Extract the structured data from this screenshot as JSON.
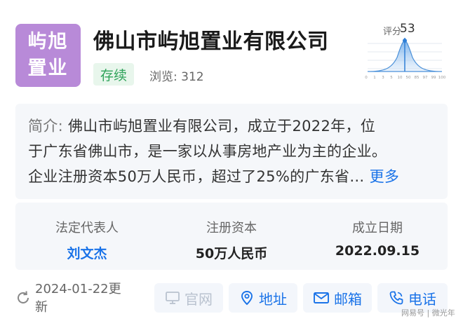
{
  "logo": {
    "line1": "屿旭",
    "line2": "置业",
    "color": "#b88ad8"
  },
  "company": {
    "name": "佛山市屿旭置业有限公司"
  },
  "status": {
    "label": "存续",
    "color": "#2fa35a"
  },
  "views": {
    "label": "浏览: 312"
  },
  "score": {
    "label": "评分",
    "value": "53",
    "ticks": [
      "0",
      "1",
      "3",
      "5",
      "10",
      "50",
      "85",
      "97",
      "99",
      "100"
    ]
  },
  "intro": {
    "prefix": "简介:",
    "line1_rest": "佛山市屿旭置业有限公司，成立于2022年，位",
    "line2": "于广东省佛山市，是一家以从事房地产业为主的企业。",
    "line3": "企业注册资本50万人民币，超过了25%的广东省…",
    "more": "更多"
  },
  "info": {
    "legal_rep_label": "法定代表人",
    "legal_rep_value": "刘文杰",
    "capital_label": "注册资本",
    "capital_value": "50万人民币",
    "date_label": "成立日期",
    "date_value": "2022.09.15"
  },
  "footer": {
    "update_line1": "2024-01-22更",
    "update_line2": "新",
    "website": "官网",
    "address": "地址",
    "email": "邮箱",
    "phone": "电话",
    "accent": "#1a73e8"
  },
  "watermark": "网易号 | 微光年"
}
